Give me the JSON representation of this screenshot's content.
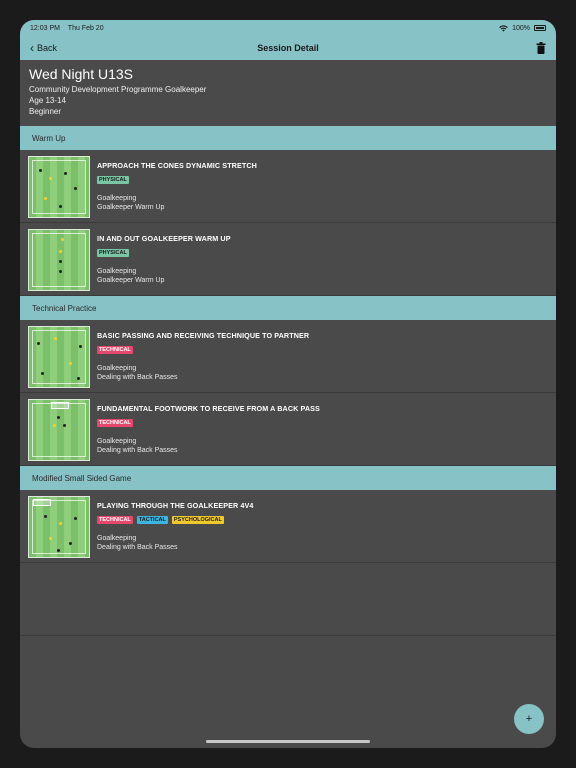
{
  "status": {
    "time": "12:03 PM",
    "date": "Thu Feb 20",
    "battery": "100%"
  },
  "nav": {
    "back_label": "Back",
    "title": "Session Detail",
    "icons": {
      "back": "chevron-left-icon",
      "delete": "trash-icon"
    }
  },
  "session": {
    "title": "Wed Night U13S",
    "programme": "Community Development Programme Goalkeeper",
    "age": "Age 13-14",
    "level": "Beginner"
  },
  "sections": [
    {
      "label": "Warm Up",
      "items": [
        {
          "name": "APPROACH THE CONES DYNAMIC STRETCH",
          "tags": [
            "PHYSICAL"
          ],
          "category": "Goalkeeping",
          "topic": "Goalkeeper Warm Up"
        },
        {
          "name": "IN AND OUT GOALKEEPER WARM UP",
          "tags": [
            "PHYSICAL"
          ],
          "category": "Goalkeeping",
          "topic": "Goalkeeper Warm Up"
        }
      ]
    },
    {
      "label": "Technical Practice",
      "items": [
        {
          "name": "BASIC PASSING AND RECEIVING TECHNIQUE TO PARTNER",
          "tags": [
            "TECHNICAL"
          ],
          "category": "Goalkeeping",
          "topic": "Dealing with Back Passes"
        },
        {
          "name": "FUNDAMENTAL FOOTWORK TO RECEIVE FROM A BACK PASS",
          "tags": [
            "TECHNICAL"
          ],
          "category": "Goalkeeping",
          "topic": "Dealing with Back Passes"
        }
      ]
    },
    {
      "label": "Modified Small Sided Game",
      "items": [
        {
          "name": "PLAYING THROUGH THE GOALKEEPER 4V4",
          "tags": [
            "TECHNICAL",
            "TACTICAL",
            "PSYCHOLOGICAL"
          ],
          "category": "Goalkeeping",
          "topic": "Dealing with Back Passes"
        }
      ]
    }
  ],
  "fab_label": "+",
  "colors": {
    "accent": "#86c2c6",
    "background": "#4a4a4a",
    "physical": "#78c6a4",
    "technical": "#e8476d",
    "tactical": "#3bb6e0",
    "psychological": "#f0c82e"
  }
}
